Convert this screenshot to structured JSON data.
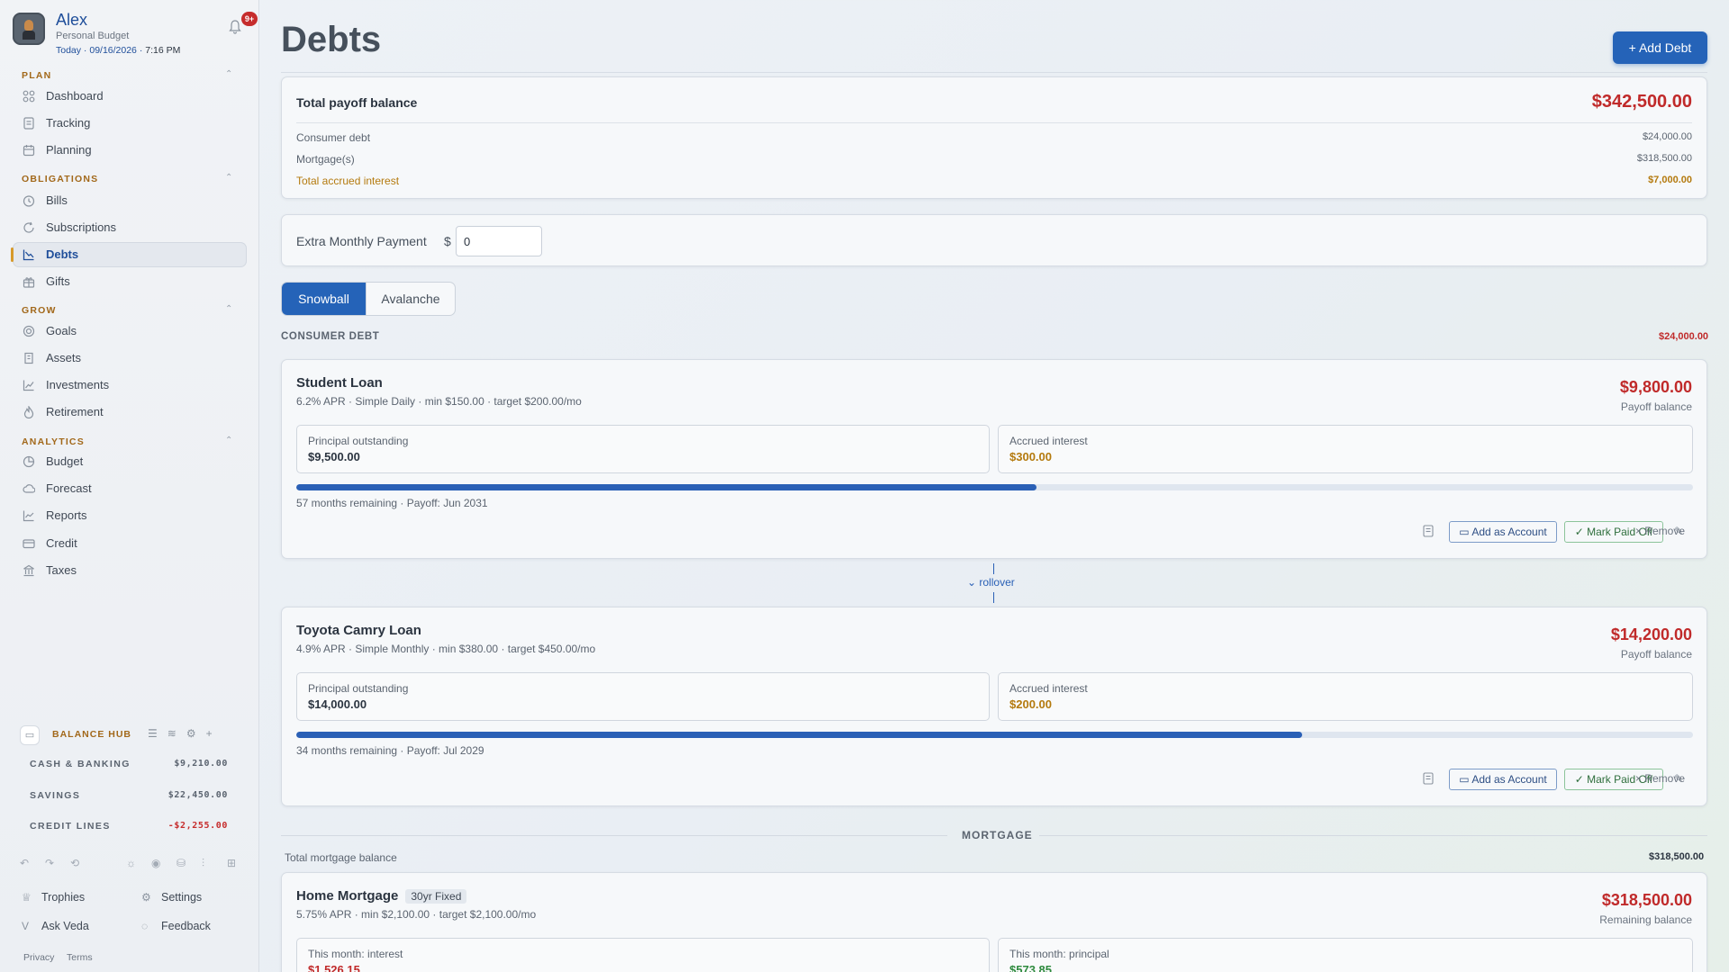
{
  "profile": {
    "name": "Alex",
    "subtitle": "Personal Budget",
    "date_prefix": "Today · 09/16/2026 ·",
    "time": "7:16 PM",
    "notifications_badge": "9+"
  },
  "nav": {
    "plan": {
      "title": "PLAN",
      "items": [
        {
          "label": "Dashboard",
          "icon": "grid-icon"
        },
        {
          "label": "Tracking",
          "icon": "receipt-icon"
        },
        {
          "label": "Planning",
          "icon": "calendar-icon"
        }
      ]
    },
    "obligations": {
      "title": "OBLIGATIONS",
      "items": [
        {
          "label": "Bills",
          "icon": "clock-icon"
        },
        {
          "label": "Subscriptions",
          "icon": "refresh-icon"
        },
        {
          "label": "Debts",
          "icon": "chart-down-icon",
          "active": true
        },
        {
          "label": "Gifts",
          "icon": "gift-icon"
        }
      ]
    },
    "grow": {
      "title": "GROW",
      "items": [
        {
          "label": "Goals",
          "icon": "target-icon"
        },
        {
          "label": "Assets",
          "icon": "building-icon"
        },
        {
          "label": "Investments",
          "icon": "trend-up-icon"
        },
        {
          "label": "Retirement",
          "icon": "flame-icon"
        }
      ]
    },
    "analytics": {
      "title": "ANALYTICS",
      "items": [
        {
          "label": "Budget",
          "icon": "pie-icon"
        },
        {
          "label": "Forecast",
          "icon": "cloud-icon"
        },
        {
          "label": "Reports",
          "icon": "line-chart-icon"
        },
        {
          "label": "Credit",
          "icon": "card-icon"
        },
        {
          "label": "Taxes",
          "icon": "bank-icon"
        }
      ]
    }
  },
  "balance_hub": {
    "title": "BALANCE HUB",
    "rows": [
      {
        "label": "CASH & BANKING",
        "value": "$9,210.00",
        "negative": false
      },
      {
        "label": "SAVINGS",
        "value": "$22,450.00",
        "negative": false
      },
      {
        "label": "CREDIT LINES",
        "value": "-$2,255.00",
        "negative": true
      }
    ]
  },
  "footer": {
    "trophies": "Trophies",
    "settings": "Settings",
    "ask_veda": "Ask Veda",
    "feedback": "Feedback",
    "privacy": "Privacy",
    "terms": "Terms"
  },
  "page": {
    "title": "Debts",
    "add_debt_label": "+ Add Debt"
  },
  "summary": {
    "title": "Total payoff balance",
    "total": "$342,500.00",
    "rows": [
      {
        "label": "Consumer debt",
        "value": "$24,000.00"
      },
      {
        "label": "Mortgage(s)",
        "value": "$318,500.00"
      },
      {
        "label": "Total accrued interest",
        "value": "$7,000.00"
      }
    ]
  },
  "extra_payment": {
    "label": "Extra Monthly Payment",
    "currency": "$",
    "value": "0"
  },
  "strategy": {
    "options": [
      "Snowball",
      "Avalanche"
    ],
    "selected": "Snowball"
  },
  "consumer_debt": {
    "label": "CONSUMER DEBT",
    "total": "$24,000.00",
    "debts": [
      {
        "name": "Student Loan",
        "meta": "6.2% APR · Simple Daily · min $150.00 · target $200.00/mo",
        "balance": "$9,800.00",
        "balance_label": "Payoff balance",
        "principal_label": "Principal outstanding",
        "principal": "$9,500.00",
        "interest_label": "Accrued interest",
        "interest": "$300.00",
        "progress": 0.53,
        "remaining": "57 months remaining · Payoff: Jun 2031"
      },
      {
        "name": "Toyota Camry Loan",
        "meta": "4.9% APR · Simple Monthly · min $380.00 · target $450.00/mo",
        "balance": "$14,200.00",
        "balance_label": "Payoff balance",
        "principal_label": "Principal outstanding",
        "principal": "$14,000.00",
        "interest_label": "Accrued interest",
        "interest": "$200.00",
        "progress": 0.72,
        "remaining": "34 months remaining · Payoff: Jul 2029"
      }
    ],
    "rollover_label": "rollover"
  },
  "actions": {
    "add_account": "Add as Account",
    "mark_paid": "Mark Paid Off",
    "remove": "× Remove"
  },
  "mortgage": {
    "label": "MORTGAGE",
    "total_label": "Total mortgage balance",
    "total": "$318,500.00",
    "item": {
      "name": "Home Mortgage",
      "tag": "30yr Fixed",
      "meta": "5.75% APR · min $2,100.00 · target $2,100.00/mo",
      "balance": "$318,500.00",
      "balance_label": "Remaining balance",
      "interest_label": "This month: interest",
      "interest": "$1,526.15",
      "principal_label": "This month: principal",
      "principal": "$573.85"
    }
  },
  "colors": {
    "accent": "#2563b8",
    "negative": "#c02a2a",
    "interest": "#b47a0e",
    "section": "#a2681a"
  }
}
